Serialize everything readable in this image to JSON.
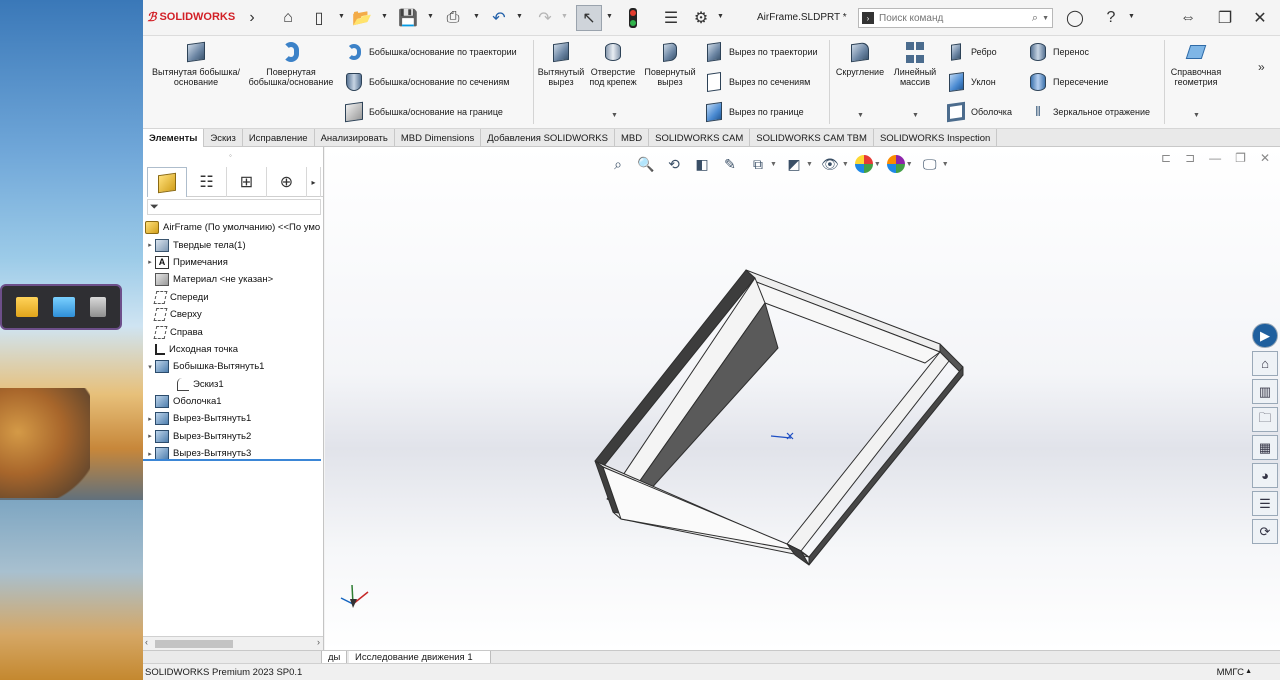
{
  "app": {
    "brand": "SOLIDWORKS",
    "document_title": "AirFrame.SLDPRT *",
    "search_placeholder": "Поиск команд"
  },
  "ribbon": {
    "extrude_boss": "Вытянутая бобышка/основание",
    "revolve_boss": "Повернутая бобышка/основание",
    "swept_boss": "Бобышка/основание по траектории",
    "loft_boss": "Бобышка/основание по сечениям",
    "boundary_boss": "Бобышка/основание на границе",
    "extrude_cut": "Вытянутый вырез",
    "hole_wizard": "Отверстие под крепеж",
    "revolve_cut": "Повернутый вырез",
    "swept_cut": "Вырез по траектории",
    "loft_cut": "Вырез по сечениям",
    "boundary_cut": "Вырез по границе",
    "fillet": "Скругление",
    "linear_pattern": "Линейный массив",
    "rib": "Ребро",
    "draft": "Уклон",
    "shell": "Оболочка",
    "wrap": "Перенос",
    "intersect": "Пересечение",
    "mirror": "Зеркальное отражение",
    "ref_geometry": "Справочная геометрия",
    "more": "»"
  },
  "tabs": [
    "Элементы",
    "Эскиз",
    "Исправление",
    "Анализировать",
    "MBD Dimensions",
    "Добавления SOLIDWORKS",
    "MBD",
    "SOLIDWORKS CAM",
    "SOLIDWORKS CAM TBM",
    "SOLIDWORKS Inspection"
  ],
  "tree": {
    "root": "AirFrame (По умолчанию) <<По умо",
    "items": [
      {
        "label": "Твердые тела(1)",
        "icon": "solid-bodies-icon",
        "expand": "▸"
      },
      {
        "label": "Примечания",
        "icon": "annotations-icon",
        "expand": "▸"
      },
      {
        "label": "Материал <не указан>",
        "icon": "material-icon",
        "expand": ""
      },
      {
        "label": "Спереди",
        "icon": "plane-icon",
        "expand": ""
      },
      {
        "label": "Сверху",
        "icon": "plane-icon",
        "expand": ""
      },
      {
        "label": "Справа",
        "icon": "plane-icon",
        "expand": ""
      },
      {
        "label": "Исходная точка",
        "icon": "origin-icon",
        "expand": ""
      },
      {
        "label": "Бобышка-Вытянуть1",
        "icon": "extrude-feature-icon",
        "expand": "▾"
      },
      {
        "label": "Эскиз1",
        "icon": "sketch-icon",
        "expand": ""
      },
      {
        "label": "Оболочка1",
        "icon": "shell-feature-icon",
        "expand": ""
      },
      {
        "label": "Вырез-Вытянуть1",
        "icon": "cut-feature-icon",
        "expand": "▸"
      },
      {
        "label": "Вырез-Вытянуть2",
        "icon": "cut-feature-icon",
        "expand": "▸"
      },
      {
        "label": "Вырез-Вытянуть3",
        "icon": "cut-feature-icon",
        "expand": "▸"
      }
    ]
  },
  "bottom_tabs": {
    "partial": "ды",
    "motion": "Исследование движения 1"
  },
  "status": {
    "product": "SOLIDWORKS Premium 2023 SP0.1",
    "units": "ММГС"
  },
  "colors": {
    "brand_red": "#d21f26",
    "accent_blue": "#3b86d6",
    "model_edge": "#3a3a3a"
  }
}
